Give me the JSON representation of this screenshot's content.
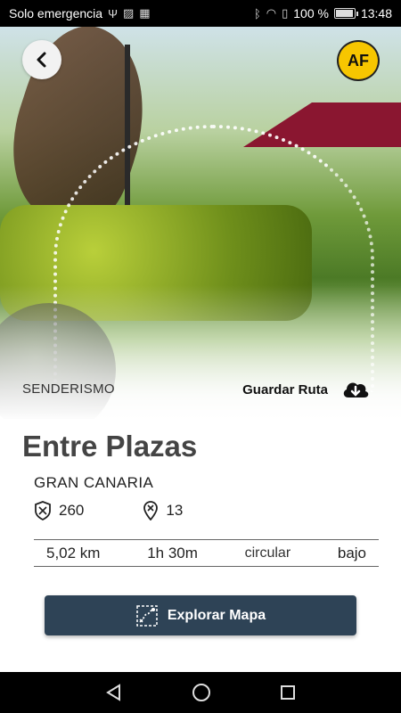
{
  "status_bar": {
    "carrier": "Solo emergencia",
    "battery_text": "100 %",
    "time": "13:48",
    "battery_level": 1.0
  },
  "header": {
    "badge_text": "AF"
  },
  "route": {
    "category": "SENDERISMO",
    "save_label": "Guardar Ruta",
    "title": "Entre Plazas",
    "region": "GRAN CANARIA",
    "stat_1": "260",
    "stat_2": "13",
    "distance": "5,02 km",
    "duration": "1h 30m",
    "type": "circular",
    "difficulty": "bajo",
    "explore_label": "Explorar Mapa"
  },
  "colors": {
    "button_bg": "#2e4356",
    "badge_bg": "#f7c600"
  },
  "icons": [
    "back-arrow-icon",
    "cloud-download-icon",
    "badge-shield-icon",
    "pin-icon",
    "map-route-icon",
    "nav-back-icon",
    "nav-home-icon",
    "nav-recents-icon"
  ]
}
